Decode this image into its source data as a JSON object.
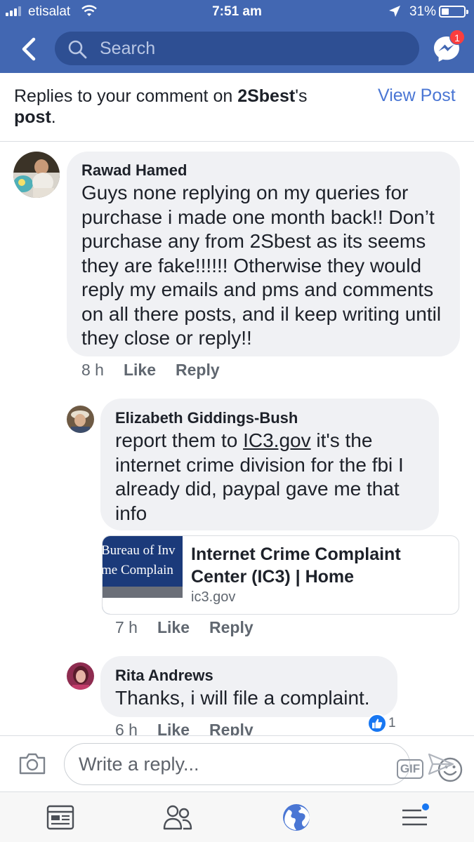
{
  "status_bar": {
    "carrier": "etisalat",
    "time": "7:51 am",
    "battery": "31%"
  },
  "header": {
    "search_placeholder": "Search",
    "messenger_badge": "1"
  },
  "subheader": {
    "prefix": "Replies to your comment on ",
    "page_name": "2Sbest",
    "suffix": "'s",
    "second_line": "post",
    "period": ".",
    "view_post": "View Post"
  },
  "comments": [
    {
      "author": "Rawad Hamed",
      "text": "Guys none replying on my queries for purchase i made one month back!! Don’t purchase any from 2Sbest as its seems they are fake!!!!!! Otherwise they would reply my emails and pms and comments on all there posts, and il keep writing until they close or reply!!",
      "time": "8 h",
      "like": "Like",
      "reply": "Reply"
    },
    {
      "author": "Elizabeth Giddings-Bush",
      "text_before": "report them to ",
      "link_text": "IC3.gov",
      "text_after": " it's the internet crime division for the fbi I already did, paypal gave me that info",
      "time": "7 h",
      "like": "Like",
      "reply": "Reply",
      "link_card": {
        "thumb_line1": "Bureau of Inv",
        "thumb_line2": "me Complain",
        "title": "Internet Crime Complaint Center (IC3) | Home",
        "domain": "ic3.gov"
      }
    },
    {
      "author": "Rita Andrews",
      "text": "Thanks, i will file a complaint.",
      "time": "6 h",
      "like": "Like",
      "reply": "Reply",
      "reaction_count": "1"
    }
  ],
  "composer": {
    "placeholder": "Write a reply...",
    "gif_label": "GIF"
  },
  "tabs": [
    "news-feed",
    "friends",
    "notifications",
    "menu"
  ],
  "colors": {
    "header_blue": "#4267b2",
    "link_blue": "#4a76d4",
    "bubble_gray": "#f0f1f4",
    "badge_red": "#fa3e3e"
  }
}
